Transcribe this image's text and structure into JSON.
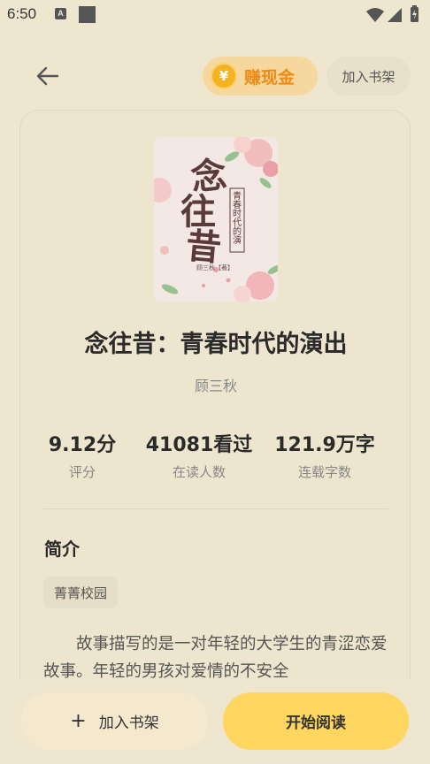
{
  "status_bar": {
    "time": "6:50",
    "notification_badge": "A"
  },
  "header": {
    "earn_coin_symbol": "¥",
    "earn_label": "赚现金",
    "add_to_shelf_label": "加入书架"
  },
  "book": {
    "cover_title_big": [
      "念",
      "往",
      "昔"
    ],
    "cover_subtitle": "青春时代的演出",
    "cover_author": "顾三秋【著】",
    "title": "念往昔：青春时代的演出",
    "author": "顾三秋",
    "stats": [
      {
        "value": "9.12分",
        "label": "评分"
      },
      {
        "value": "41081看过",
        "label": "在读人数"
      },
      {
        "value": "121.9万字",
        "label": "连载字数"
      }
    ],
    "intro_heading": "简介",
    "tag": "菁菁校园",
    "intro_text": "故事描写的是一对年轻的大学生的青涩恋爱故事。年轻的男孩对爱情的不安全"
  },
  "bottom": {
    "add_to_shelf_label": "加入书架",
    "add_icon": "+",
    "start_reading_label": "开始阅读"
  },
  "colors": {
    "background": "#EEE6CE",
    "accent_yellow": "#FFD660",
    "earn_orange": "#F08A14"
  }
}
